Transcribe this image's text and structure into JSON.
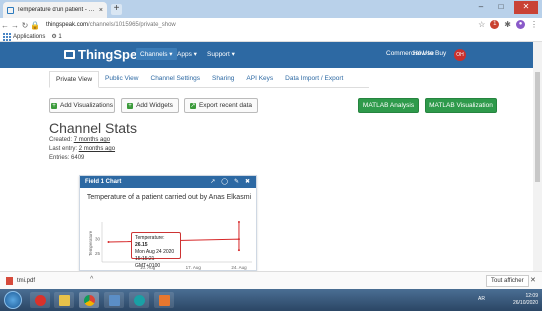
{
  "browser": {
    "tab_title": "Temperature d'un patient - Thin",
    "tab_close": "×",
    "new_tab": "+",
    "url_host": "thingspeak.com",
    "url_path": "/channels/1015965/private_show",
    "bookmarks": {
      "apps_label": "Applications",
      "item_label": "1"
    },
    "window_min": "–",
    "window_max": "□",
    "window_close": "✕"
  },
  "nav": {
    "logo": "ThingSpeak",
    "trademark": "™",
    "items": [
      "Channels ▾",
      "Apps ▾",
      "Support ▾"
    ],
    "right_items": [
      "Commercial Use",
      "How to Buy"
    ],
    "user_initials": "OH"
  },
  "subtabs": [
    "Private View",
    "Public View",
    "Channel Settings",
    "Sharing",
    "API Keys",
    "Data Import / Export"
  ],
  "buttons": {
    "add_visualizations": "Add Visualizations",
    "add_widgets": "Add Widgets",
    "export_recent": "Export recent data",
    "matlab_analysis": "MATLAB Analysis",
    "matlab_visualization": "MATLAB Visualization"
  },
  "stats": {
    "title": "Channel Stats",
    "created_label": "Created:",
    "created_value": "7 months ago",
    "last_entry_label": "Last entry:",
    "last_entry_value": "2 months ago",
    "entries_label": "Entries:",
    "entries_value": "6409"
  },
  "field_chart": {
    "header": "Field 1 Chart",
    "tools": [
      "↗",
      "◯",
      "✎",
      "✖"
    ]
  },
  "chart_data": {
    "type": "line",
    "title": "Temperature of a patient carried out by Anas Elkasmi",
    "xlabel": "",
    "ylabel": "Temperature",
    "x_tick_labels": [
      "10. Aug",
      "17. Aug",
      "24. Aug"
    ],
    "y_tick_labels": [
      "25",
      "30"
    ],
    "ylim": [
      22,
      36
    ],
    "series": [
      {
        "values": [
          {
            "x": "2020-08-04",
            "y": 29
          },
          {
            "x": "2020-08-24",
            "y": 30
          },
          {
            "x": "2020-08-24",
            "y": 26.15
          },
          {
            "x": "2020-08-24",
            "y": 36
          }
        ],
        "color": "#d62728"
      }
    ],
    "tooltip": {
      "label": "Temperature:",
      "value": "26.15",
      "date": "Mon Aug 24 2020",
      "time": "15:15:21 GMT+0100"
    }
  },
  "downloads": {
    "file": "tmi.pdf",
    "chevron": "^",
    "show_all": "Tout afficher",
    "close": "✕"
  },
  "taskbar": {
    "lang": "AR",
    "time": "12:09",
    "date": "26/10/2020"
  }
}
